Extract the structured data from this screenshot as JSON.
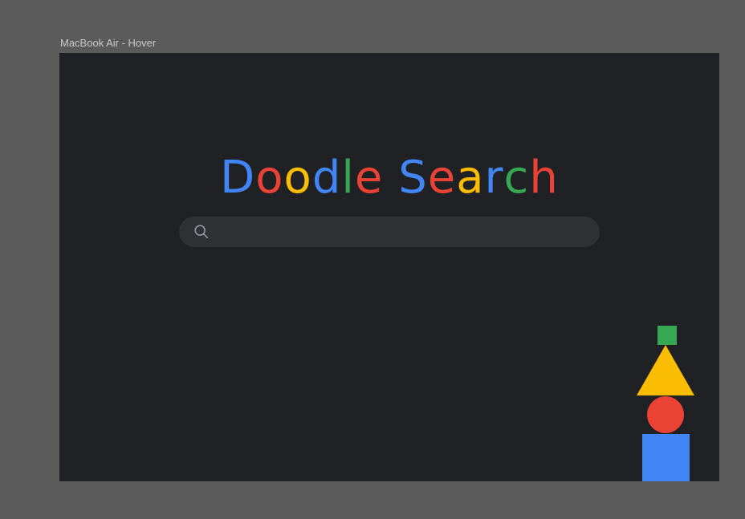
{
  "frame": {
    "label": "MacBook Air - Hover"
  },
  "logo": {
    "letters": [
      {
        "char": "D",
        "color": "#4285f4"
      },
      {
        "char": "o",
        "color": "#ea4335"
      },
      {
        "char": "o",
        "color": "#fbbc04"
      },
      {
        "char": "d",
        "color": "#4285f4"
      },
      {
        "char": "l",
        "color": "#34a853"
      },
      {
        "char": "e",
        "color": "#ea4335"
      },
      {
        "char": " ",
        "color": "#ffffff"
      },
      {
        "char": "S",
        "color": "#4285f4"
      },
      {
        "char": "e",
        "color": "#ea4335"
      },
      {
        "char": "a",
        "color": "#fbbc04"
      },
      {
        "char": "r",
        "color": "#4285f4"
      },
      {
        "char": "c",
        "color": "#34a853"
      },
      {
        "char": "h",
        "color": "#ea4335"
      }
    ]
  },
  "search": {
    "icon": "search-icon",
    "value": "",
    "placeholder": ""
  },
  "colors": {
    "blue": "#4285f4",
    "red": "#ea4335",
    "yellow": "#fbbc04",
    "green": "#34a853",
    "background": "#202124",
    "search_bar": "#303134"
  }
}
